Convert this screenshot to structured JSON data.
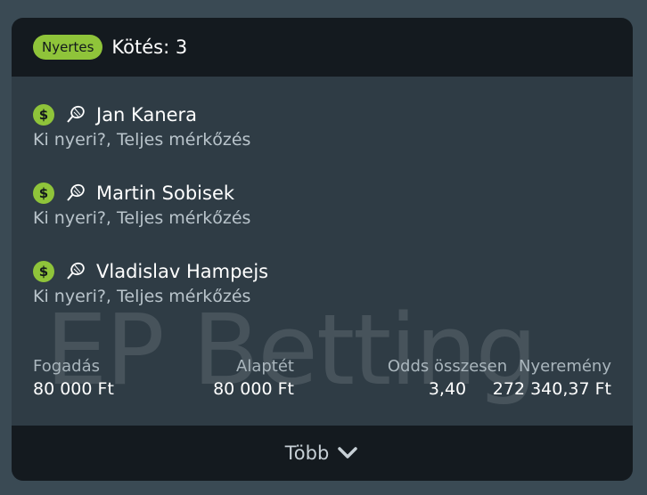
{
  "header": {
    "status_badge": "Nyertes",
    "title": "Kötés: 3"
  },
  "watermark": "EP Betting",
  "selections": [
    {
      "icons": [
        "dollar-icon",
        "tennis-icon"
      ],
      "player": "Jan Kanera",
      "market": "Ki nyeri?, Teljes mérkőzés"
    },
    {
      "icons": [
        "dollar-icon",
        "tennis-icon"
      ],
      "player": "Martin Sobisek",
      "market": "Ki nyeri?, Teljes mérkőzés"
    },
    {
      "icons": [
        "dollar-icon",
        "tennis-icon"
      ],
      "player": "Vladislav Hampejs",
      "market": "Ki nyeri?, Teljes mérkőzés"
    }
  ],
  "dollar_glyph": "$",
  "stats": {
    "stake": {
      "label": "Fogadás",
      "value": "80 000 Ft"
    },
    "base": {
      "label": "Alaptét",
      "value": "80 000 Ft"
    },
    "odds": {
      "label": "Odds összesen",
      "value": "3,40"
    },
    "win": {
      "label": "Nyeremény",
      "value": "272 340,37 Ft"
    }
  },
  "footer": {
    "more_label": "Több"
  },
  "colors": {
    "accent": "#8fc43a",
    "header_bg": "#141a1f",
    "card_bg": "#2f3c45",
    "page_bg": "#3a4a54"
  }
}
